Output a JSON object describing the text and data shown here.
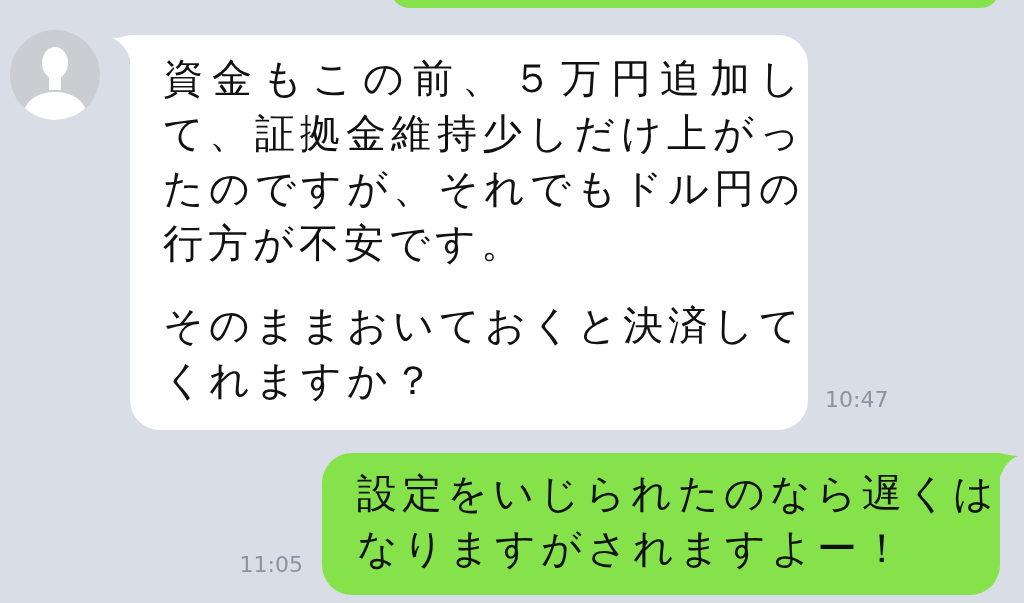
{
  "messages": [
    {
      "kind": "outgoing"
    },
    {
      "kind": "incoming",
      "paragraphs": [
        "資金もこの前、５万円追加して、証拠金維持少しだけ上がったのですが、それでもドル円の行方が不安です。",
        "そのままおいておくと決済してくれますか？"
      ],
      "time": "10:47"
    },
    {
      "kind": "outgoing",
      "paragraphs": [
        "設定をいじられたのなら遅くはなりますがされますよー！"
      ],
      "time": "11:05"
    }
  ]
}
